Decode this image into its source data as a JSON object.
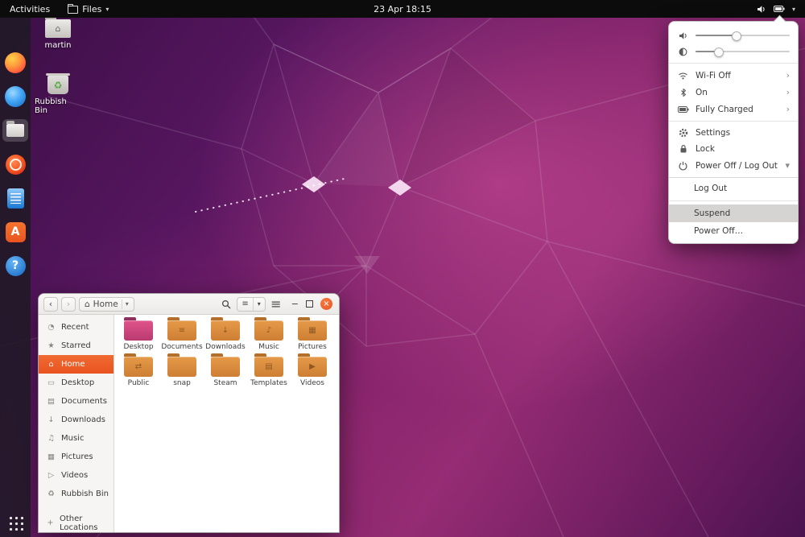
{
  "topbar": {
    "activities": "Activities",
    "app_menu": "Files",
    "clock": "23 Apr 18:15"
  },
  "icons": {
    "caret_down": "▾",
    "chevron_right": "›",
    "back": "‹",
    "forward": "›",
    "minimize": "−",
    "close": "×",
    "hamburger": "≡",
    "list_view": "≡",
    "home": "⌂"
  },
  "dock": {
    "items": [
      {
        "name": "firefox",
        "glyph": ""
      },
      {
        "name": "thunderbird",
        "glyph": ""
      },
      {
        "name": "files",
        "glyph": "",
        "active": true
      },
      {
        "name": "rhythmbox",
        "glyph": ""
      },
      {
        "name": "libreoffice-writer",
        "glyph": ""
      },
      {
        "name": "ubuntu-software",
        "glyph": "A"
      },
      {
        "name": "help",
        "glyph": "?"
      }
    ]
  },
  "desktop_icons": [
    {
      "label": "martin",
      "emblem": "⌂"
    },
    {
      "label": "Rubbish Bin",
      "emblem": "♻"
    }
  ],
  "system_menu": {
    "volume_percent": 43,
    "brightness_percent": 24,
    "network_label": "Wi-Fi Off",
    "bluetooth_label": "On",
    "battery_label": "Fully Charged",
    "settings_label": "Settings",
    "lock_label": "Lock",
    "power_label": "Power Off / Log Out",
    "submenu": [
      {
        "label": "Log Out"
      },
      {
        "label": "Suspend",
        "highlighted": true
      },
      {
        "label": "Power Off…"
      }
    ]
  },
  "files_window": {
    "location": "Home",
    "sidebar": [
      {
        "icon": "◔",
        "label": "Recent"
      },
      {
        "icon": "★",
        "label": "Starred"
      },
      {
        "icon": "⌂",
        "label": "Home",
        "selected": true
      },
      {
        "icon": "▭",
        "label": "Desktop"
      },
      {
        "icon": "▤",
        "label": "Documents"
      },
      {
        "icon": "↓",
        "label": "Downloads"
      },
      {
        "icon": "♫",
        "label": "Music"
      },
      {
        "icon": "▦",
        "label": "Pictures"
      },
      {
        "icon": "▷",
        "label": "Videos"
      },
      {
        "icon": "♻",
        "label": "Rubbish Bin"
      },
      {
        "icon": "+",
        "label": "Other Locations"
      }
    ],
    "folders": [
      {
        "label": "Desktop",
        "variant": "desktop",
        "emblem": ""
      },
      {
        "label": "Documents",
        "emblem": "≡"
      },
      {
        "label": "Downloads",
        "emblem": "↓"
      },
      {
        "label": "Music",
        "emblem": "♪"
      },
      {
        "label": "Pictures",
        "emblem": "▦"
      },
      {
        "label": "Public",
        "emblem": "⇄"
      },
      {
        "label": "snap",
        "emblem": ""
      },
      {
        "label": "Steam",
        "emblem": ""
      },
      {
        "label": "Templates",
        "emblem": "▤"
      },
      {
        "label": "Videos",
        "emblem": "▶"
      }
    ]
  },
  "colors": {
    "accent": "#E95420",
    "panel_bg": "#0C0C0C",
    "suspend_highlight": "#D6D4D2"
  }
}
